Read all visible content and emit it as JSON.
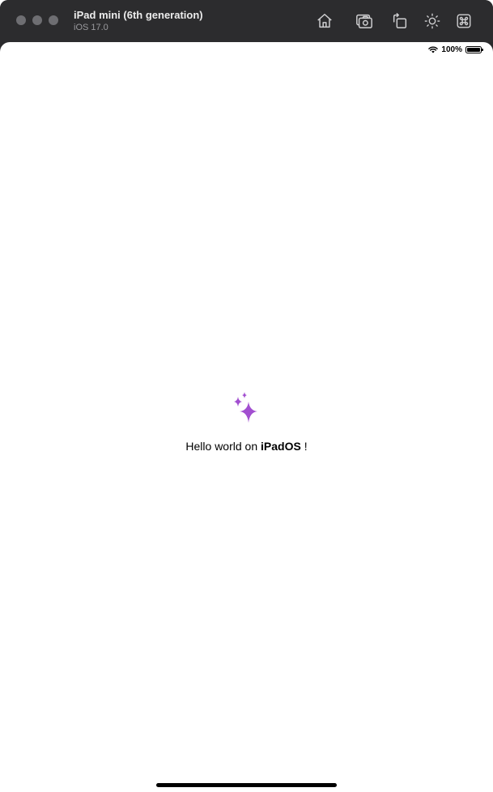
{
  "window": {
    "device_name": "iPad mini (6th generation)",
    "os_version": "iOS 17.0"
  },
  "toolbar": {
    "buttons": [
      {
        "icon": "home-icon"
      },
      {
        "icon": "screenshot-icon"
      },
      {
        "icon": "rotate-icon"
      },
      {
        "icon": "brightness-icon"
      },
      {
        "icon": "command-icon"
      }
    ]
  },
  "statusbar": {
    "battery_text": "100%",
    "battery_level": 1.0
  },
  "content": {
    "icon": "sparkles-icon",
    "accent_color": "#a24fd0",
    "hello_prefix": "Hello world on ",
    "hello_bold": "iPadOS",
    "hello_suffix": " !"
  }
}
